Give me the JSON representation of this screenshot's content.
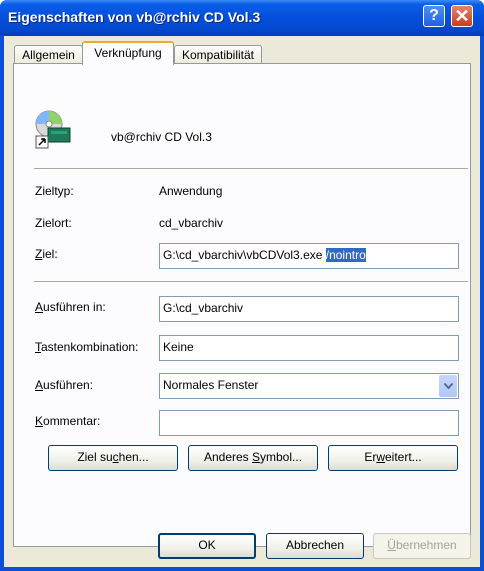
{
  "window": {
    "title": "Eigenschaften von vb@rchiv CD Vol.3",
    "help_glyph": "?",
    "close_glyph": "✕"
  },
  "tabs": [
    {
      "label": "Allgemein"
    },
    {
      "label": "Verknüpfung"
    },
    {
      "label": "Kompatibilität"
    }
  ],
  "shortcut": {
    "name": "vb@rchiv CD Vol.3",
    "zieltyp_label": "Zieltyp:",
    "zieltyp_value": "Anwendung",
    "zielort_label": "Zielort:",
    "zielort_value": "cd_vbarchiv",
    "ziel_label_rest": "iel:",
    "ziel_value_path": "G:\\cd_vbarchiv\\vbCDVol3.exe ",
    "ziel_value_selected": "/nointro",
    "ausfuehren_in_label_rest": "usführen in:",
    "ausfuehren_in_value": "G:\\cd_vbarchiv",
    "tasten_label_rest": "astenkombination:",
    "tasten_value": "Keine",
    "run_label_rest": "usführen:",
    "run_value": "Normales Fenster",
    "kommentar_label_rest": "ommentar:",
    "kommentar_value": ""
  },
  "buttons": {
    "ziel_suchen_pre": "Ziel su",
    "ziel_suchen_key": "c",
    "ziel_suchen_post": "hen...",
    "anderes_symbol_pre": "Anderes ",
    "anderes_symbol_key": "S",
    "anderes_symbol_post": "ymbol...",
    "erweitert_pre": "Er",
    "erweitert_key": "w",
    "erweitert_post": "eitert...",
    "ok": "OK",
    "abbrechen": "Abbrechen",
    "uebernehmen_key": "Ü",
    "uebernehmen_post": "bernehmen"
  },
  "colors": {
    "titlebar": "#0550dc",
    "selection": "#316ac5",
    "tab_highlight": "#f4a534"
  }
}
